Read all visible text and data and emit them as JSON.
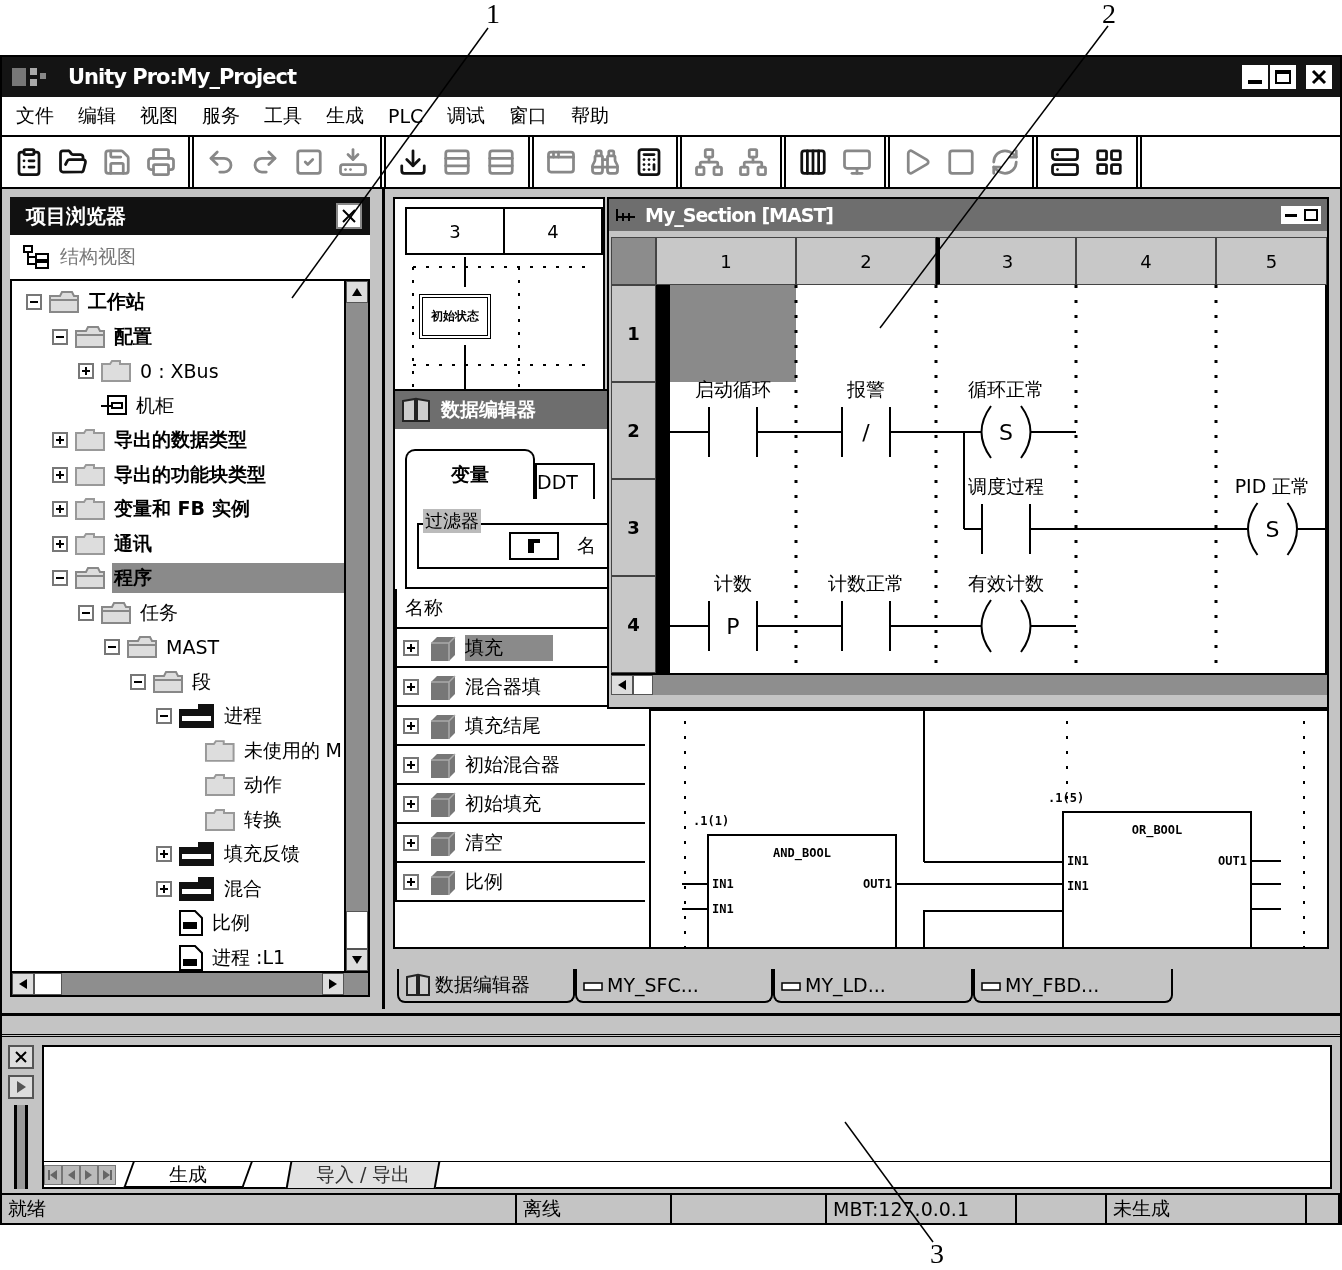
{
  "callouts": [
    {
      "label": "1"
    },
    {
      "label": "2"
    },
    {
      "label": "3"
    }
  ],
  "window": {
    "title": "Unity Pro:My_Project"
  },
  "menu": [
    "文件",
    "编辑",
    "视图",
    "服务",
    "工具",
    "生成",
    "PLC",
    "调试",
    "窗口",
    "帮助"
  ],
  "project_browser": {
    "title": "项目浏览器",
    "view_label": "结构视图",
    "tree": [
      {
        "label": "工作站",
        "kind": "folder",
        "expanded": true,
        "selected": false,
        "children": [
          {
            "label": "配置",
            "kind": "folder",
            "expanded": true,
            "selected": false,
            "children": [
              {
                "label": "0 : XBus",
                "kind": "folder",
                "expanded": false,
                "selected": false
              },
              {
                "label": "机柜",
                "kind": "rack",
                "selected": false
              }
            ]
          },
          {
            "label": "导出的数据类型",
            "kind": "folder",
            "expanded": false,
            "selected": false
          },
          {
            "label": "导出的功能块类型",
            "kind": "folder",
            "expanded": false,
            "selected": false
          },
          {
            "label": "变量和 FB 实例",
            "kind": "folder",
            "expanded": false,
            "selected": false
          },
          {
            "label": "通讯",
            "kind": "folder",
            "expanded": false,
            "selected": false
          },
          {
            "label": "程序",
            "kind": "folder",
            "expanded": true,
            "selected": true,
            "children": [
              {
                "label": "任务",
                "kind": "folder",
                "expanded": true,
                "selected": false,
                "children": [
                  {
                    "label": "MAST",
                    "kind": "folder",
                    "expanded": true,
                    "selected": false,
                    "children": [
                      {
                        "label": "段",
                        "kind": "folder",
                        "expanded": true,
                        "selected": false,
                        "children": [
                          {
                            "label": "进程",
                            "kind": "sfc",
                            "expanded": true,
                            "selected": false,
                            "children": [
                              {
                                "label": "未使用的 M",
                                "kind": "folder",
                                "selected": false
                              },
                              {
                                "label": "动作",
                                "kind": "folder",
                                "selected": false
                              },
                              {
                                "label": "转换",
                                "kind": "folder",
                                "selected": false
                              }
                            ]
                          },
                          {
                            "label": "填充反馈",
                            "kind": "sfc",
                            "expanded": false,
                            "selected": false
                          },
                          {
                            "label": "混合",
                            "kind": "sfc",
                            "expanded": false,
                            "selected": false
                          },
                          {
                            "label": "比例",
                            "kind": "st",
                            "selected": false
                          },
                          {
                            "label": "进程 :L1",
                            "kind": "ld",
                            "selected": false
                          }
                        ]
                      }
                    ]
                  }
                ]
              }
            ]
          }
        ]
      }
    ]
  },
  "sfc_window": {
    "columns": [
      "3",
      "4"
    ],
    "step": "初始状态"
  },
  "data_editor": {
    "title": "数据编辑器",
    "tabs": [
      {
        "label": "变量",
        "selected": true
      },
      {
        "label": "DDT",
        "selected": false
      }
    ],
    "filter": {
      "label": "过滤器",
      "field_label": "名"
    },
    "column": "名称",
    "rows": [
      {
        "name": "填充",
        "expanded": false,
        "selected": true
      },
      {
        "name": "混合器填",
        "expanded": false,
        "selected": false
      },
      {
        "name": "填充结尾",
        "expanded": false,
        "selected": false
      },
      {
        "name": "初始混合器",
        "expanded": false,
        "selected": false
      },
      {
        "name": "初始填充",
        "expanded": false,
        "selected": false
      },
      {
        "name": "清空",
        "expanded": false,
        "selected": false
      },
      {
        "name": "比例",
        "expanded": false,
        "selected": false
      }
    ]
  },
  "fbd": {
    "blocks": [
      {
        "label": ".1(1)",
        "type": "AND_BOOL",
        "inputs": [
          "IN1",
          "IN1"
        ],
        "outputs": [
          "OUT1"
        ]
      },
      {
        "label": ".1(5)",
        "type": "OR_BOOL",
        "inputs": [
          "IN1",
          "IN1"
        ],
        "outputs": [
          "OUT1"
        ]
      }
    ]
  },
  "ld_window": {
    "title": "My_Section [MAST]",
    "columns": [
      "1",
      "2",
      "3",
      "4",
      "5"
    ],
    "rows": [
      {
        "label": "1",
        "cells": [
          {
            "kind": "empty",
            "selected": true
          },
          {
            "kind": "empty",
            "selected": false
          },
          {
            "kind": "empty",
            "selected": false
          },
          {
            "kind": "empty",
            "selected": false
          },
          {
            "kind": "empty",
            "selected": false
          }
        ]
      },
      {
        "label": "2",
        "cells": [
          {
            "kind": "contact",
            "label": "启动循环",
            "selected": false
          },
          {
            "kind": "contact",
            "label": "报警",
            "symbol": "/",
            "selected": false
          },
          {
            "kind": "coil",
            "label": "循环正常",
            "symbol": "S",
            "selected": false
          },
          {
            "kind": "empty",
            "selected": false
          },
          {
            "kind": "empty",
            "selected": false
          }
        ]
      },
      {
        "label": "3",
        "joins_above": true,
        "cells": [
          {
            "kind": "empty",
            "selected": false
          },
          {
            "kind": "empty",
            "selected": false
          },
          {
            "kind": "contact",
            "label": "调度过程",
            "selected": false
          },
          {
            "kind": "wire",
            "selected": false
          },
          {
            "kind": "coil",
            "label": "PID 正常",
            "symbol": "S",
            "selected": false
          }
        ]
      },
      {
        "label": "4",
        "cells": [
          {
            "kind": "contact",
            "label": "计数",
            "symbol": "P",
            "selected": false
          },
          {
            "kind": "contact",
            "label": "计数正常",
            "selected": false
          },
          {
            "kind": "coil",
            "label": "有效计数",
            "selected": false
          },
          {
            "kind": "empty",
            "selected": false
          },
          {
            "kind": "empty",
            "selected": false
          }
        ]
      }
    ]
  },
  "document_tabs": [
    {
      "label": "数据编辑器",
      "selected": false
    },
    {
      "label": "MY_SFC...",
      "selected": false
    },
    {
      "label": "MY_LD...",
      "selected": false
    },
    {
      "label": "MY_FBD...",
      "selected": false
    }
  ],
  "output": {
    "tabs": [
      {
        "label": "生成",
        "selected": true
      },
      {
        "label": "导入 / 导出",
        "selected": false
      }
    ]
  },
  "status_bar": [
    "就绪",
    "离线",
    "MBT:127.0.0.1",
    "未生成"
  ]
}
